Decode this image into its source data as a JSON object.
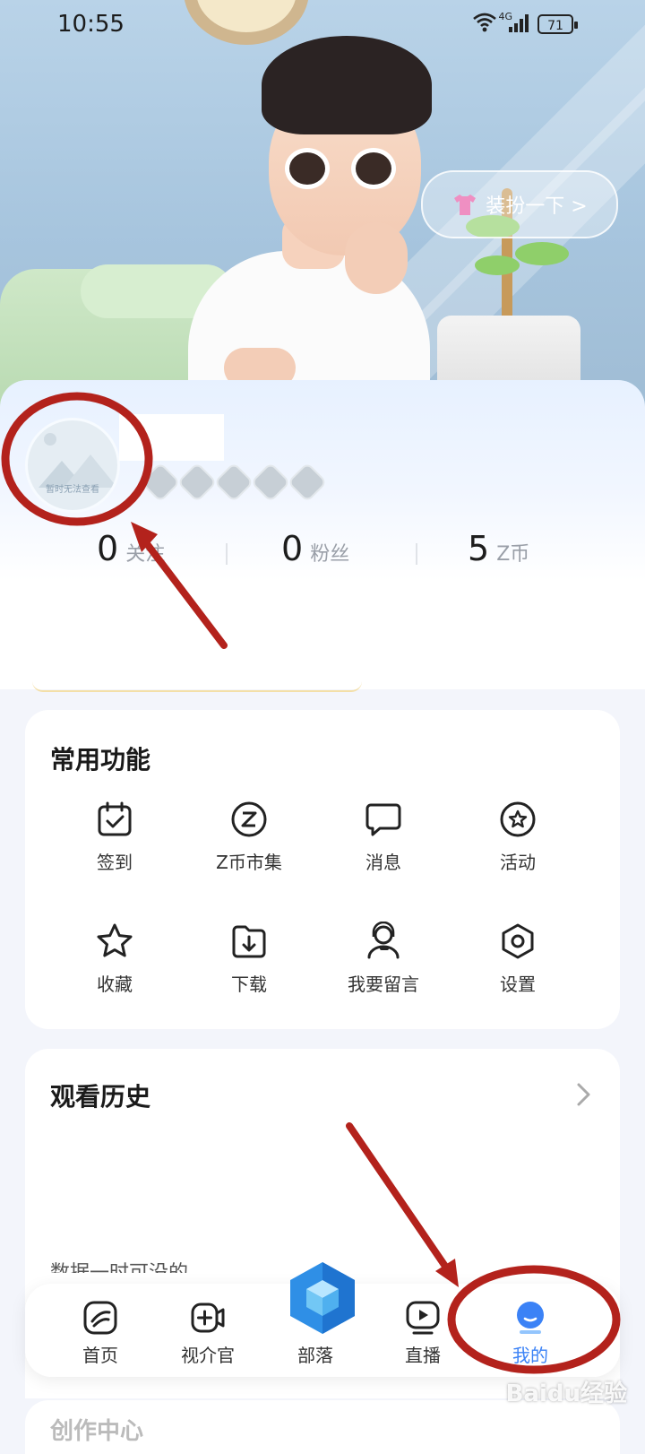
{
  "status_bar": {
    "time": "10:55",
    "network": "4G",
    "battery": "71"
  },
  "hero": {
    "dress_up_label": "装扮一下 >"
  },
  "profile": {
    "avatar_caption": "暂时无法查看",
    "stats": [
      {
        "value": "0",
        "label": "关注"
      },
      {
        "value": "0",
        "label": "粉丝"
      },
      {
        "value": "5",
        "label": "Z币"
      }
    ]
  },
  "common_functions": {
    "title": "常用功能",
    "items": [
      {
        "label": "签到",
        "icon": "calendar-check-icon"
      },
      {
        "label": "Z币市集",
        "icon": "z-coin-icon"
      },
      {
        "label": "消息",
        "icon": "chat-bubble-icon"
      },
      {
        "label": "活动",
        "icon": "star-badge-icon"
      },
      {
        "label": "收藏",
        "icon": "star-icon"
      },
      {
        "label": "下载",
        "icon": "download-folder-icon"
      },
      {
        "label": "我要留言",
        "icon": "headset-icon"
      },
      {
        "label": "设置",
        "icon": "settings-hexagon-icon"
      }
    ]
  },
  "history": {
    "title": "观看历史",
    "peek_text": "数据一时可没的",
    "next_section": "创作中心"
  },
  "bottom_nav": {
    "items": [
      {
        "label": "首页",
        "icon": "home-icon"
      },
      {
        "label": "视介官",
        "icon": "video-plus-icon"
      },
      {
        "label": "部落",
        "icon": "cube-icon"
      },
      {
        "label": "直播",
        "icon": "live-play-icon"
      },
      {
        "label": "我的",
        "icon": "profile-icon"
      }
    ]
  },
  "watermark": "Baidu经验",
  "colors": {
    "accent": "#3b82f6",
    "annotation": "#b3221c"
  }
}
